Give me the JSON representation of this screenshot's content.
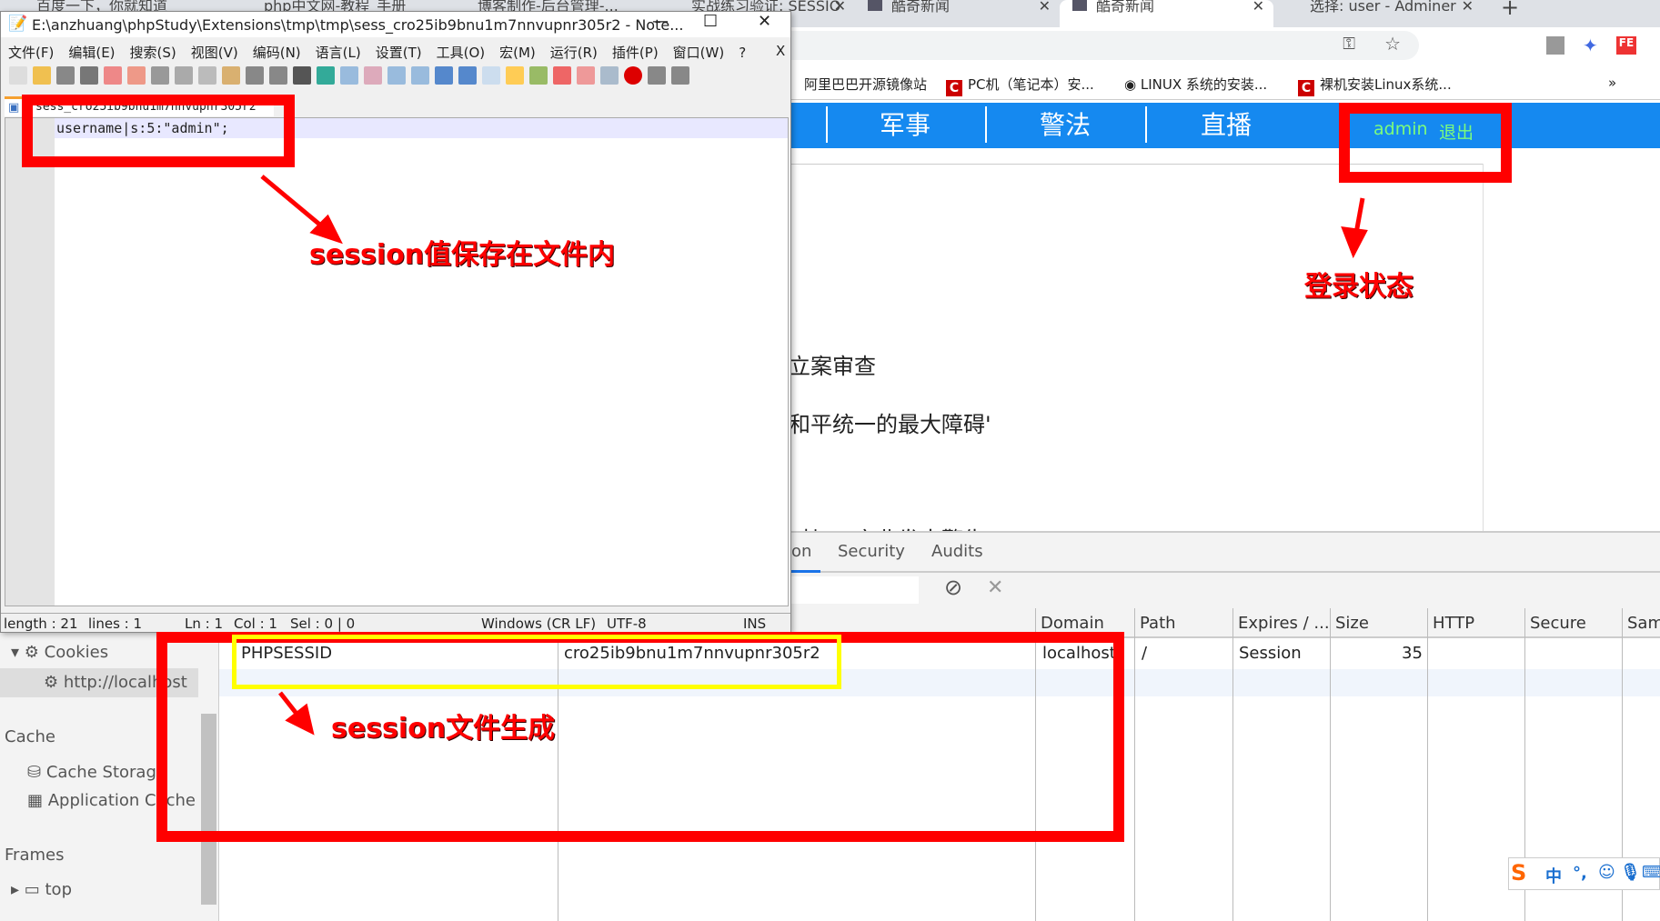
{
  "browser": {
    "tabs": [
      {
        "label": "百度一下，你就知道"
      },
      {
        "label": "php中文网-教程_手册"
      },
      {
        "label": "博客制作-后台管理-..."
      },
      {
        "label": "实战练习验证: SESSIO"
      },
      {
        "label": "酷奇新闻"
      },
      {
        "label": "酷奇新闻",
        "active": true
      },
      {
        "label": "选择: user - Adminer"
      }
    ],
    "new_tab": "+",
    "bookmarks": [
      {
        "label": "阿里巴巴开源镜像站"
      },
      {
        "label": "PC机（笔记本）安..."
      },
      {
        "label": "LINUX 系统的安装..."
      },
      {
        "label": "裸机安装Linux系统..."
      }
    ],
    "bookmarks_more": "»"
  },
  "site": {
    "nav": [
      "军事",
      "警法",
      "直播"
    ],
    "user": "admin",
    "logout": "退出",
    "accent": "#1589f0",
    "user_color": "#7cfc7c",
    "articles": [
      "立案审查",
      "和平统一的最大障碍'",
      "对加工产业发出警告"
    ]
  },
  "devtools": {
    "tabs": [
      "on",
      "Security",
      "Audits"
    ],
    "sidebar": {
      "cookies": "Cookies",
      "cookie_host": "http://localhost",
      "cache": "Cache",
      "cache_storage": "Cache Storage",
      "app_cache": "Application Cache",
      "frames": "Frames",
      "top": "top"
    },
    "columns": [
      "Domain",
      "Path",
      "Expires / ...",
      "Size",
      "HTTP",
      "Secure",
      "Sam"
    ],
    "rows": [
      {
        "name": "PHPSESSID",
        "value": "cro25ib9bnu1m7nnvupnr305r2",
        "domain": "localhost",
        "path": "/",
        "expires": "Session",
        "size": "35"
      }
    ]
  },
  "notepad": {
    "title": "E:\\anzhuang\\phpStudy\\Extensions\\tmp\\tmp\\sess_cro25ib9bnu1m7nnvupnr305r2 - Note...",
    "menu": [
      "文件(F)",
      "编辑(E)",
      "搜索(S)",
      "视图(V)",
      "编码(N)",
      "语言(L)",
      "设置(T)",
      "工具(O)",
      "宏(M)",
      "运行(R)",
      "插件(P)",
      "窗口(W)",
      "?"
    ],
    "tab": "sess_cro25ib9bnu1m7nnvupnr305r2",
    "content": "username|s:5:\"admin\";",
    "status": {
      "length": "length : 21",
      "lines": "lines : 1",
      "ln": "Ln : 1",
      "col": "Col : 1",
      "sel": "Sel : 0 | 0",
      "eol": "Windows (CR LF)",
      "enc": "UTF-8",
      "mode": "INS"
    }
  },
  "annotations": {
    "file": "session值保存在文件内",
    "login": "登录状态",
    "cookie": "session文件生成"
  },
  "ime": {
    "label": "中"
  }
}
